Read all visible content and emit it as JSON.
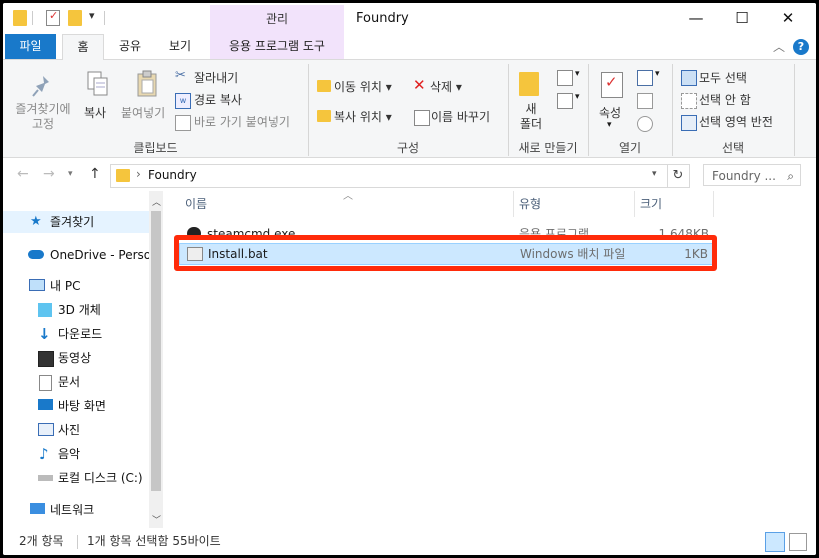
{
  "window": {
    "title": "Foundry",
    "context_tab_header": "관리",
    "buttons": {
      "minimize": "—",
      "maximize": "☐",
      "close": "✕"
    }
  },
  "ribbon_tabs": {
    "file": "파일",
    "home": "홈",
    "share": "공유",
    "view": "보기",
    "app_tools": "응용 프로그램 도구"
  },
  "ribbon": {
    "pin": "즐겨찾기에\n고정",
    "pin_line1": "즐겨찾기에",
    "pin_line2": "고정",
    "copy": "복사",
    "paste": "붙여넣기",
    "cut": "잘라내기",
    "copy_path": "경로 복사",
    "paste_shortcut": "바로 가기 붙여넣기",
    "clipboard_group": "클립보드",
    "move_to": "이동 위치",
    "copy_to": "복사 위치",
    "delete": "삭제",
    "rename": "이름 바꾸기",
    "organize_group": "구성",
    "new_folder_line1": "새",
    "new_folder_line2": "폴더",
    "new_group": "새로 만들기",
    "properties": "속성",
    "open_group": "열기",
    "select_all": "모두 선택",
    "select_none": "선택 안 함",
    "invert_selection": "선택 영역 반전",
    "select_group": "선택"
  },
  "address": {
    "path": "Foundry",
    "search_placeholder": "Foundry ..."
  },
  "nav": {
    "quick_access": "즐겨찾기",
    "onedrive": "OneDrive - Persor",
    "this_pc": "내 PC",
    "objects3d": "3D 개체",
    "downloads": "다운로드",
    "videos": "동영상",
    "documents": "문서",
    "desktop": "바탕 화면",
    "pictures": "사진",
    "music": "음악",
    "local_disk": "로컬 디스크 (C:)",
    "network": "네트워크"
  },
  "columns": {
    "name": "이름",
    "type": "유형",
    "size": "크기"
  },
  "files": [
    {
      "name": "steamcmd.exe",
      "type": "응용 프로그램",
      "size": "1,648KB"
    },
    {
      "name": "Install.bat",
      "type": "Windows 배치 파일",
      "size": "1KB"
    }
  ],
  "status": {
    "count": "2개 항목",
    "selection": "1개 항목 선택함 55바이트"
  },
  "colors": {
    "accent": "#1979ca",
    "selection": "#cce8ff",
    "highlight_border": "#ff2b0a"
  }
}
